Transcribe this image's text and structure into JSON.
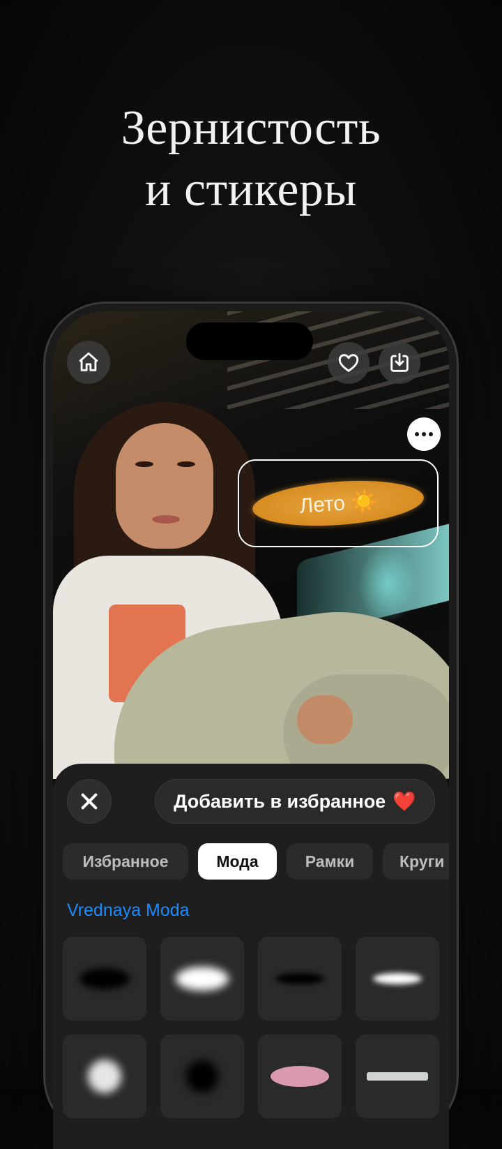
{
  "headline": {
    "line1": "Зернистость",
    "line2": "и стикеры"
  },
  "topbar": {
    "home_icon": "home-icon",
    "heart_icon": "heart-icon",
    "download_icon": "download-icon",
    "more_icon": "more-icon"
  },
  "sticker": {
    "text": "Лето ☀️",
    "color": "#e09a30"
  },
  "sheet": {
    "close_icon": "close-icon",
    "favorite_label": "Добавить в избранное",
    "favorite_emoji": "❤️",
    "tabs": [
      "Избранное",
      "Мода",
      "Рамки",
      "Круги"
    ],
    "active_tab": "Мода",
    "section_title": "Vrednaya Moda",
    "accent": "#1a8cff"
  }
}
